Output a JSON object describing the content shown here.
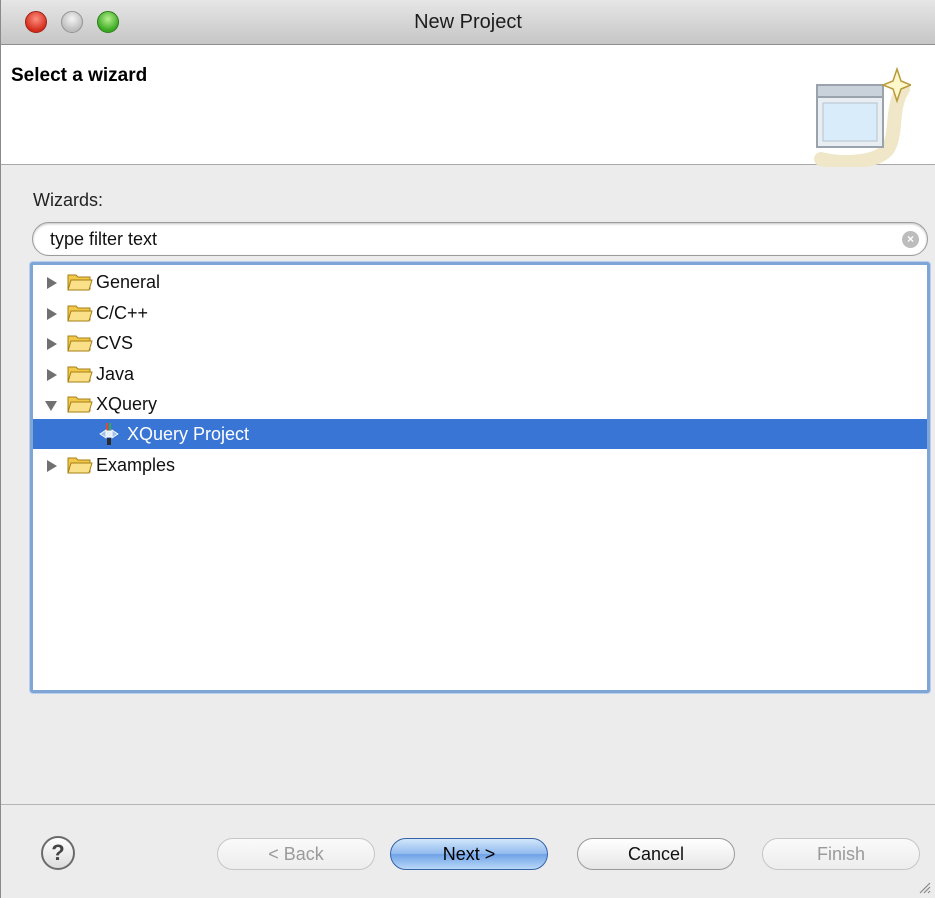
{
  "window": {
    "title": "New Project"
  },
  "banner": {
    "heading": "Select a wizard"
  },
  "wizards": {
    "label": "Wizards:",
    "filter_text": "type filter text",
    "tree": [
      {
        "label": "General",
        "expanded": false
      },
      {
        "label": "C/C++",
        "expanded": false
      },
      {
        "label": "CVS",
        "expanded": false
      },
      {
        "label": "Java",
        "expanded": false
      },
      {
        "label": "XQuery",
        "expanded": true
      },
      {
        "label": "XQuery Project",
        "selected": true
      },
      {
        "label": "Examples",
        "expanded": false
      }
    ]
  },
  "footer": {
    "help_symbol": "?",
    "back_label": "< Back",
    "next_label": "Next >",
    "cancel_label": "Cancel",
    "finish_label": "Finish"
  },
  "colors": {
    "selection": "#3975d4",
    "focus_border": "#7fa5d6",
    "folder": "#f1c84a"
  }
}
